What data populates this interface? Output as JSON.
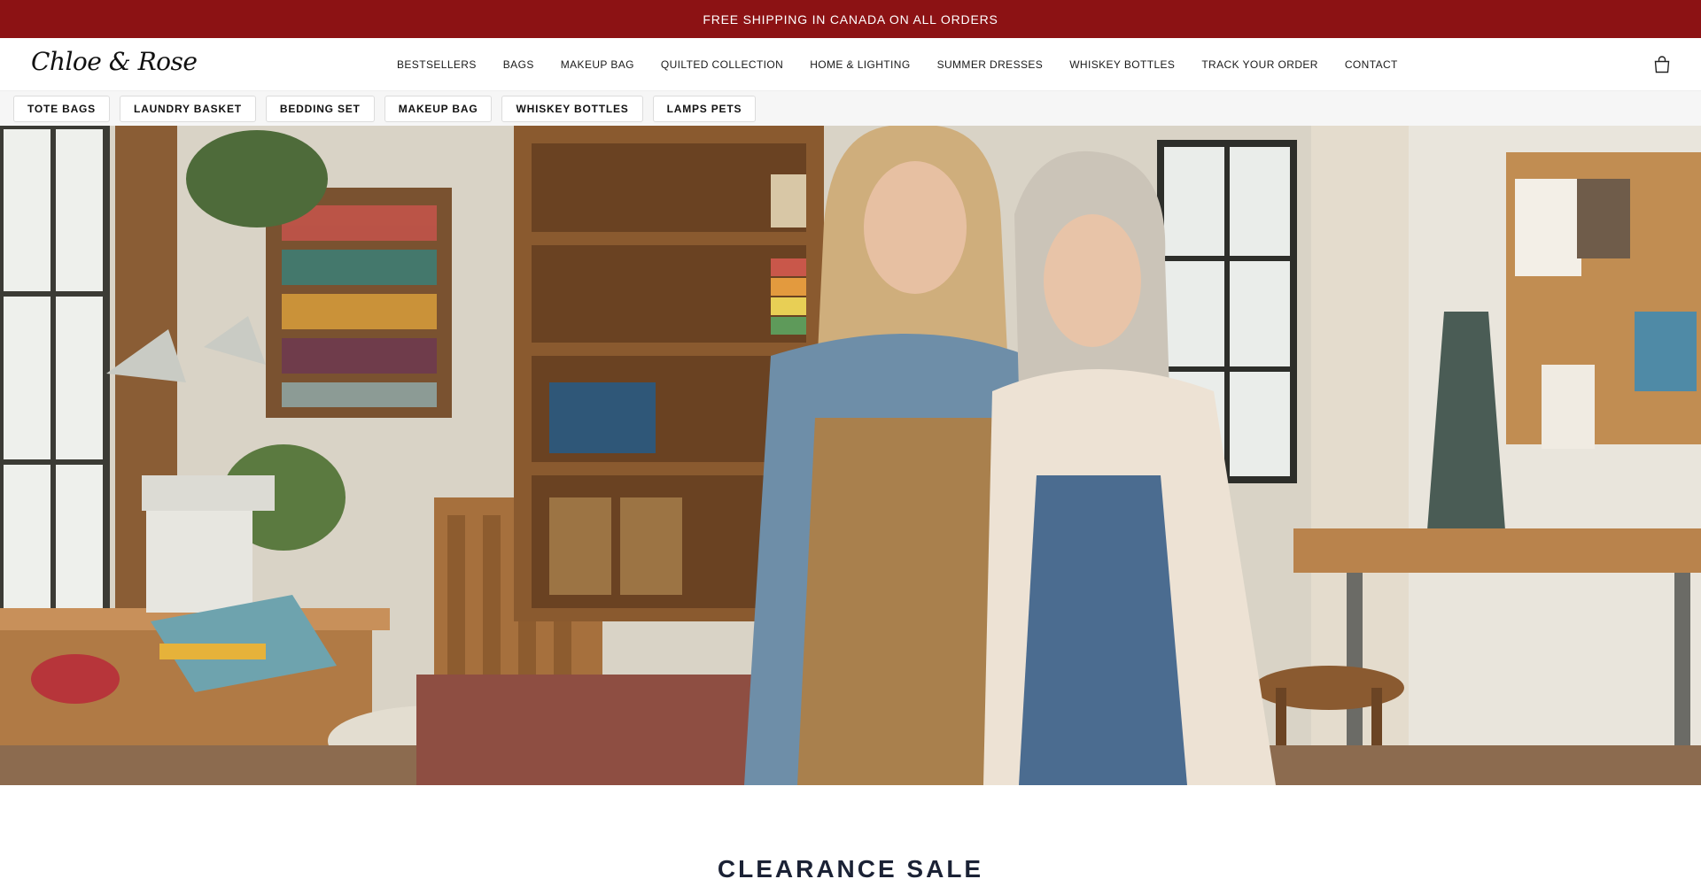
{
  "announcement": {
    "text": "FREE SHIPPING IN CANADA ON ALL ORDERS",
    "bg_color": "#8c1214"
  },
  "header": {
    "logo": "Chloe & Rose",
    "nav": [
      {
        "label": "BESTSELLERS"
      },
      {
        "label": "BAGS"
      },
      {
        "label": "MAKEUP BAG"
      },
      {
        "label": "QUILTED COLLECTION"
      },
      {
        "label": "HOME & LIGHTING"
      },
      {
        "label": "SUMMER DRESSES"
      },
      {
        "label": "WHISKEY BOTTLES"
      },
      {
        "label": "TRACK YOUR ORDER"
      },
      {
        "label": "CONTACT"
      }
    ],
    "cart_icon": "shopping-bag-icon"
  },
  "categories": [
    {
      "label": "TOTE BAGS"
    },
    {
      "label": "LAUNDRY BASKET"
    },
    {
      "label": "BEDDING SET"
    },
    {
      "label": "MAKEUP BAG"
    },
    {
      "label": "WHISKEY BOTTLES"
    },
    {
      "label": "LAMPS PETS"
    }
  ],
  "hero": {
    "image": "hero-photo-two-women-in-aprons-in-sewing-studio"
  },
  "main": {
    "section_title": "CLEARANCE SALE"
  }
}
